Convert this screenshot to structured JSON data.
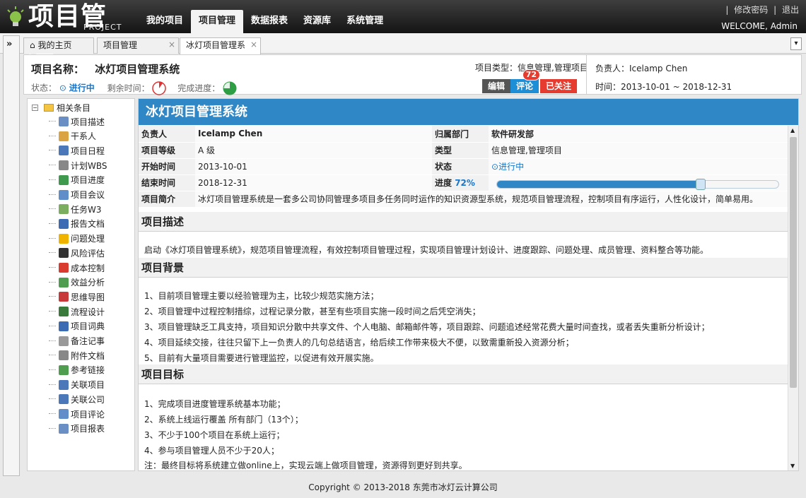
{
  "app": {
    "logo_cn": "项目管理",
    "logo_en": "PROJECT"
  },
  "nav": {
    "items": [
      "我的项目",
      "项目管理",
      "数据报表",
      "资源库",
      "系统管理"
    ],
    "active_index": 1
  },
  "toplinks": {
    "change_password": "修改密码",
    "logout": "退出",
    "welcome": "WELCOME, Admin"
  },
  "tabs": [
    {
      "label": "我的主页",
      "icon": "home-icon"
    },
    {
      "label": "项目管理",
      "close": "×"
    },
    {
      "label": "冰灯项目管理系",
      "close": "×"
    }
  ],
  "header": {
    "title_label": "项目名称：",
    "title_value": "冰灯项目管理系统",
    "status_label": "状态：",
    "status_value": "进行中",
    "remaining_label": "剩余时间：",
    "progress_label": "完成进度：",
    "type_label": "项目类型：",
    "type_value": "信息管理,管理项目",
    "btn_edit": "编辑",
    "btn_comment": "评论",
    "comment_count": "72",
    "btn_follow": "已关注",
    "owner_label": "负责人：",
    "owner_value": "Icelamp Chen",
    "time_label": "时间：",
    "time_value": "2013-10-01 ~ 2018-12-31"
  },
  "tree": {
    "root": "相关条目",
    "items": [
      {
        "label": "项目描述",
        "icon": "doc-icon",
        "color": "#6a8fc4"
      },
      {
        "label": "干系人",
        "icon": "people-icon",
        "color": "#d9a441"
      },
      {
        "label": "项目日程",
        "icon": "calendar-icon",
        "color": "#4a78b8"
      },
      {
        "label": "计划WBS",
        "icon": "wbs-icon",
        "color": "#888888"
      },
      {
        "label": "项目进度",
        "icon": "globe-icon",
        "color": "#3f9a4e"
      },
      {
        "label": "项目会议",
        "icon": "meeting-icon",
        "color": "#5f8ec9"
      },
      {
        "label": "任务W3",
        "icon": "task-icon",
        "color": "#7cae5f"
      },
      {
        "label": "报告文档",
        "icon": "report-icon",
        "color": "#3b6cb3"
      },
      {
        "label": "问题处理",
        "icon": "warning-icon",
        "color": "#f0b400"
      },
      {
        "label": "风险评估",
        "icon": "bomb-icon",
        "color": "#333333"
      },
      {
        "label": "成本控制",
        "icon": "yen-icon",
        "color": "#d93b2f"
      },
      {
        "label": "效益分析",
        "icon": "chart-icon",
        "color": "#4f9e4f"
      },
      {
        "label": "思维导图",
        "icon": "mindmap-icon",
        "color": "#c83a3a"
      },
      {
        "label": "流程设计",
        "icon": "flow-icon",
        "color": "#3a7a3a"
      },
      {
        "label": "项目词典",
        "icon": "dictionary-icon",
        "color": "#3b6cb3"
      },
      {
        "label": "备注记事",
        "icon": "note-icon",
        "color": "#999999"
      },
      {
        "label": "附件文档",
        "icon": "attach-icon",
        "color": "#888888"
      },
      {
        "label": "参考链接",
        "icon": "link-icon",
        "color": "#4f9e4f"
      },
      {
        "label": "关联项目",
        "icon": "relate-icon",
        "color": "#4a78b8"
      },
      {
        "label": "关联公司",
        "icon": "company-icon",
        "color": "#4a78b8"
      },
      {
        "label": "项目评论",
        "icon": "comment-icon",
        "color": "#5f8ec9"
      },
      {
        "label": "项目报表",
        "icon": "table-icon",
        "color": "#6a8fc4"
      }
    ]
  },
  "main": {
    "title": "冰灯项目管理系统",
    "info": {
      "owner_label": "负责人",
      "owner_value": "Icelamp Chen",
      "dept_label": "归属部门",
      "dept_value": "软件研发部",
      "level_label": "项目等级",
      "level_value": "A 级",
      "type_label": "类型",
      "type_value": "信息管理,管理项目",
      "start_label": "开始时间",
      "start_value": "2013-10-01",
      "status_label": "状态",
      "status_value": "进行中",
      "end_label": "结束时间",
      "end_value": "2018-12-31",
      "progress_label": "进度",
      "progress_value": "72%",
      "progress_fraction": 0.72,
      "intro_label": "项目简介",
      "intro_value": "冰灯项目管理系统是一套多公司协同管理多项目多任务同时运作的知识资源型系统，规范项目管理流程，控制项目有序运行，人性化设计，简单易用。"
    },
    "sections": [
      {
        "title": "项目描述",
        "lines": [
          "启动《冰灯项目管理系统》，规范项目管理流程，有效控制项目管理过程，实现项目管理计划设计、进度跟踪、问题处理、成员管理、资料整合等功能。"
        ]
      },
      {
        "title": "项目背景",
        "lines": [
          "1、目前项目管理主要以经验管理为主，比较少规范实施方法；",
          "2、项目管理中过程控制措综，过程记录分散，甚至有些项目实施一段时间之后凭空消失；",
          "3、项目管理缺乏工具支持，项目知识分散中共享文件、个人电脑、邮箱邮件等，项目跟踪、问题追述经常花费大量时间查找，或者丢失重新分析设计；",
          "4、项目延续交接，往往只留下上一负责人的几句总结语言，给后续工作带来极大不便，以致需重新投入资源分析；",
          "5、目前有大量项目需要进行管理监控，以促进有效开展实施。"
        ]
      },
      {
        "title": "项目目标",
        "lines": [
          "1、完成项目进度管理系统基本功能；",
          "2、系统上线运行覆盖 所有部门（13个）；",
          "3、不少于100个项目在系统上运行；",
          "4、参与项目管理人员不少于20人；",
          "注：最终目标将系统建立做online上，实现云端上做项目管理，资源得到更好到共享。"
        ]
      }
    ]
  },
  "footer": "Copyright © 2013-2018 东莞市冰灯云计算公司"
}
